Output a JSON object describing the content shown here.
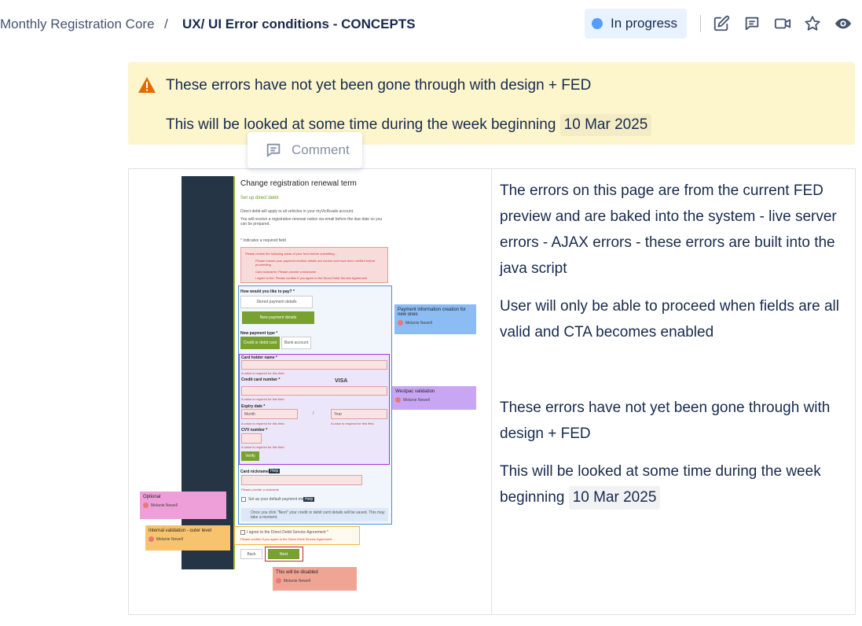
{
  "header": {
    "breadcrumb_parent": "Monthly Registration Core",
    "breadcrumb_sep": "/",
    "page_title": "UX/ UI Error conditions - CONCEPTS",
    "status_label": "In progress",
    "icons": [
      "edit-icon",
      "comment-icon",
      "video-icon",
      "star-icon",
      "eye-icon"
    ]
  },
  "warning": {
    "line1": "These errors have not yet been gone through with design + FED",
    "line2_prefix": "This will be looked at some time during the week beginning",
    "date": "10 Mar 2025"
  },
  "comment_float": {
    "label": "Comment"
  },
  "right_column": {
    "para1": "The errors on this page are from the current FED preview and are baked into the system - live server errors - AJAX errors - these errors are built into the java script",
    "para2": "User will only be able to proceed when fields are all valid and CTA becomes enabled",
    "para3": "These errors have not yet been gone through with design + FED",
    "para4_prefix": "This will be looked at some time during the week beginning",
    "date": "10 Mar 2025"
  },
  "mock": {
    "title": "Change registration renewal term",
    "subtitle": "Set up direct debit",
    "intro1": "Direct debit will apply to all vehicles in your myVicRoads account.",
    "intro2": "You will receive a registration renewal notice via email before the due date so you can be prepared.",
    "required_note": "* Indicates a required field",
    "error_heading": "Please review the following areas of your form before submitting...",
    "error_items": [
      "Please ensure your payment method details are correct and have been verified before proceeding",
      "Card nickname: Please provide a nickname",
      "I agree to the: Please confirm if you agree to the Direct Debit Service Agreement"
    ],
    "pay_question": "How would you like to pay? *",
    "stored_btn": "Stored payment details",
    "new_btn": "New payment details",
    "new_type_label": "New payment type *",
    "card_btn": "Credit or debit card",
    "bank_btn": "Bank account",
    "holder_label": "Card holder name *",
    "required_err": "A value is required for this field.",
    "card_label": "Credit card number *",
    "expiry_label": "Expiry date *",
    "month_ph": "Month",
    "year_ph": "Year",
    "cvv_label": "CVV number *",
    "verify_btn": "Verify",
    "nickname_label": "Card nickname *",
    "help": "Help",
    "nickname_err": "Please provide a nickname",
    "default_label": "Set as your default payment method",
    "info_text": "Once you click \"Next\" your credit or debit card details will be saved. This may take a moment.",
    "agree_label": "I agree to the Direct Debit Service Agreement *",
    "agree_err": "Please confirm if you agree to the Direct Debit Service Agreement",
    "back_btn": "Back",
    "next_btn": "Next",
    "notes": {
      "payment": "Payment information creation for new ones",
      "westpac": "Westpac validation",
      "optional": "Optional",
      "internal": "Internal validation - outer level",
      "disabled": "This will be disabled",
      "author": "Melanie Newell"
    }
  },
  "colors": {
    "warning_bg": "#fdf5cc",
    "status_bg": "#e9f2ff",
    "status_dot": "#579dff",
    "warning_icon": "#e06c00"
  }
}
